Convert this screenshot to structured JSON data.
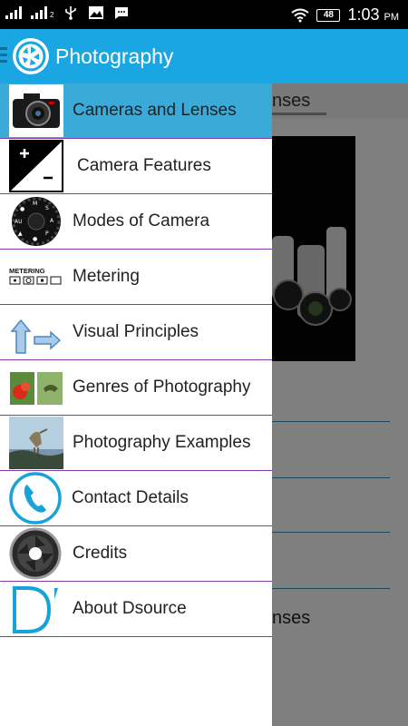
{
  "status_bar": {
    "time": "1:03",
    "ampm": "PM",
    "battery": "48",
    "sim_label": "2"
  },
  "app_bar": {
    "title": "Photography"
  },
  "background": {
    "tab_label": "nses",
    "partial_text": "nses"
  },
  "drawer": {
    "items": [
      {
        "label": "Cameras and Lenses",
        "icon": "camera-thumbnail"
      },
      {
        "label": "Camera Features",
        "icon": "exposure-thumbnail"
      },
      {
        "label": "Modes of Camera",
        "icon": "mode-dial-thumbnail"
      },
      {
        "label": "Metering",
        "icon": "metering-thumbnail"
      },
      {
        "label": "Visual Principles",
        "icon": "arrows-thumbnail"
      },
      {
        "label": "Genres of Photography",
        "icon": "genres-thumbnail"
      },
      {
        "label": "Photography Examples",
        "icon": "heron-thumbnail"
      },
      {
        "label": "Contact Details",
        "icon": "phone-icon"
      },
      {
        "label": "Credits",
        "icon": "aperture-icon"
      },
      {
        "label": "About Dsource",
        "icon": "dsource-logo"
      }
    ],
    "metering_caption": "METERING"
  },
  "colors": {
    "app_bar": "#1aa6e2",
    "active_item": "#3aaad9",
    "divider": "#8a3aa8"
  }
}
